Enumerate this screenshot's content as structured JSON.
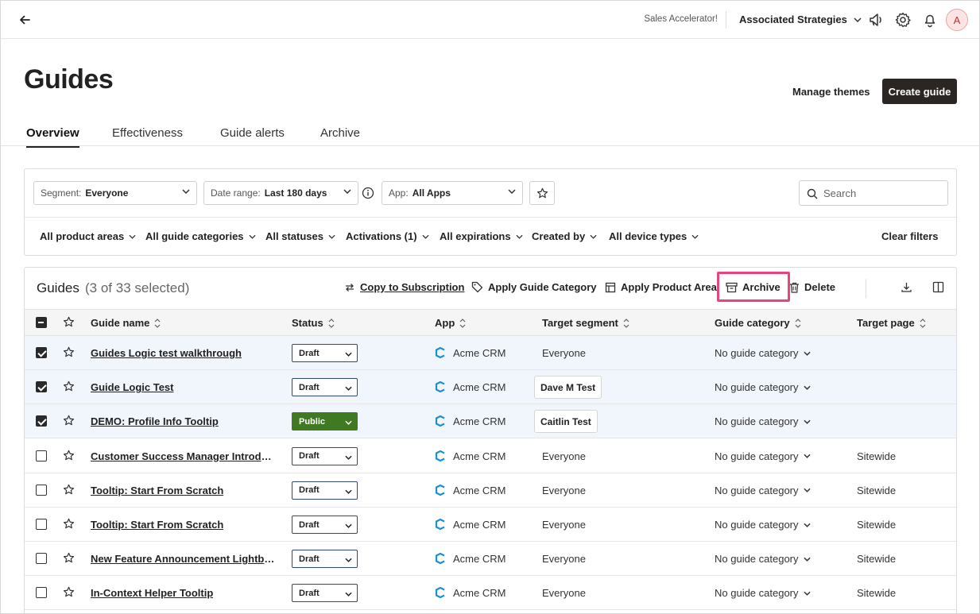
{
  "topbar": {
    "accelerator": "Sales Accelerator!",
    "org_name": "Associated Strategies",
    "avatar_initial": "A"
  },
  "page": {
    "title": "Guides",
    "manage_themes": "Manage themes",
    "create_guide": "Create guide"
  },
  "tabs": [
    {
      "label": "Overview",
      "active": true
    },
    {
      "label": "Effectiveness",
      "active": false
    },
    {
      "label": "Guide alerts",
      "active": false
    },
    {
      "label": "Archive",
      "active": false
    }
  ],
  "filters": {
    "segment": {
      "label": "Segment:",
      "value": "Everyone"
    },
    "date_range": {
      "label": "Date range:",
      "value": "Last 180 days"
    },
    "app": {
      "label": "App:",
      "value": "All Apps"
    },
    "search_placeholder": "Search",
    "dropdowns": [
      "All product areas",
      "All guide categories",
      "All statuses",
      "Activations (1)",
      "All expirations",
      "Created by",
      "All device types"
    ],
    "clear": "Clear filters"
  },
  "table": {
    "title": "Guides",
    "count": "(3 of 33 selected)",
    "actions": {
      "copy": "Copy to Subscription",
      "apply_category": "Apply Guide Category",
      "apply_product_area": "Apply Product Area",
      "archive": "Archive",
      "delete": "Delete"
    },
    "columns": [
      "Guide name",
      "Status",
      "App",
      "Target segment",
      "Guide category",
      "Target page"
    ],
    "rows": [
      {
        "name": "Guides Logic test walkthrough",
        "status": "Draft",
        "app": "Acme CRM",
        "segment": "Everyone",
        "segment_chip": false,
        "category": "No guide category",
        "page": "",
        "selected": true
      },
      {
        "name": "Guide Logic Test",
        "status": "Draft",
        "app": "Acme CRM",
        "segment": "Dave M Test",
        "segment_chip": true,
        "category": "No guide category",
        "page": "",
        "selected": true
      },
      {
        "name": "DEMO: Profile Info Tooltip",
        "status": "Public",
        "app": "Acme CRM",
        "segment": "Caitlin Test",
        "segment_chip": true,
        "category": "No guide category",
        "page": "",
        "selected": true
      },
      {
        "name": "Customer Success Manager Introdu...",
        "status": "Draft",
        "app": "Acme CRM",
        "segment": "Everyone",
        "segment_chip": false,
        "category": "No guide category",
        "page": "Sitewide",
        "selected": false
      },
      {
        "name": "Tooltip: Start From Scratch",
        "status": "Draft",
        "app": "Acme CRM",
        "segment": "Everyone",
        "segment_chip": false,
        "category": "No guide category",
        "page": "Sitewide",
        "selected": false
      },
      {
        "name": "Tooltip: Start From Scratch",
        "status": "Draft",
        "app": "Acme CRM",
        "segment": "Everyone",
        "segment_chip": false,
        "category": "No guide category",
        "page": "Sitewide",
        "selected": false
      },
      {
        "name": "New Feature Announcement Lightbox",
        "status": "Draft",
        "app": "Acme CRM",
        "segment": "Everyone",
        "segment_chip": false,
        "category": "No guide category",
        "page": "Sitewide",
        "selected": false
      },
      {
        "name": "In-Context Helper Tooltip",
        "status": "Draft",
        "app": "Acme CRM",
        "segment": "Everyone",
        "segment_chip": false,
        "category": "No guide category",
        "page": "Sitewide",
        "selected": false
      }
    ]
  },
  "colors": {
    "highlight": "#e8447e",
    "public_status": "#3f7a23",
    "primary_button": "#2b2623",
    "selected_row": "#f1f6fc",
    "app_icon": "#1a8fd6"
  }
}
